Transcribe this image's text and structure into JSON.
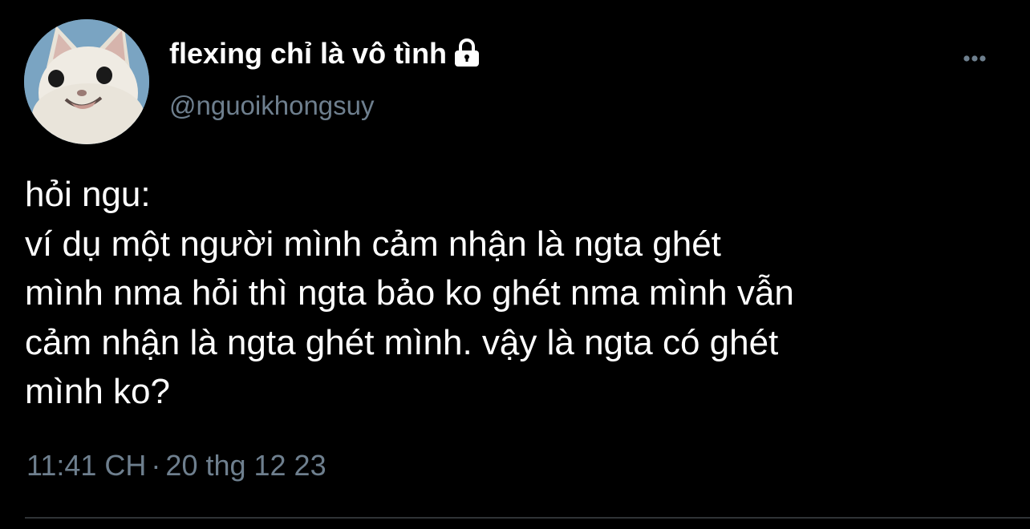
{
  "user": {
    "display_name": "flexing chỉ là vô tình",
    "handle": "@nguoikhongsuy",
    "avatar_icon": "cat-avatar",
    "protected_icon": "lock-icon"
  },
  "tweet": {
    "lines": [
      "hỏi ngu:",
      "ví dụ một người mình cảm nhận là ngta ghét",
      "mình nma hỏi thì ngta bảo ko ghét nma mình vẫn",
      "cảm nhận là ngta ghét mình. vậy là ngta có ghét",
      "mình ko?"
    ]
  },
  "meta": {
    "time": "11:41 CH",
    "separator": "·",
    "date": "20 thg 12 23"
  },
  "more_icon": "more-horizontal-icon",
  "colors": {
    "background": "#000000",
    "text": "#ffffff",
    "secondary": "#6e7f8e",
    "divider": "#2f3336"
  }
}
